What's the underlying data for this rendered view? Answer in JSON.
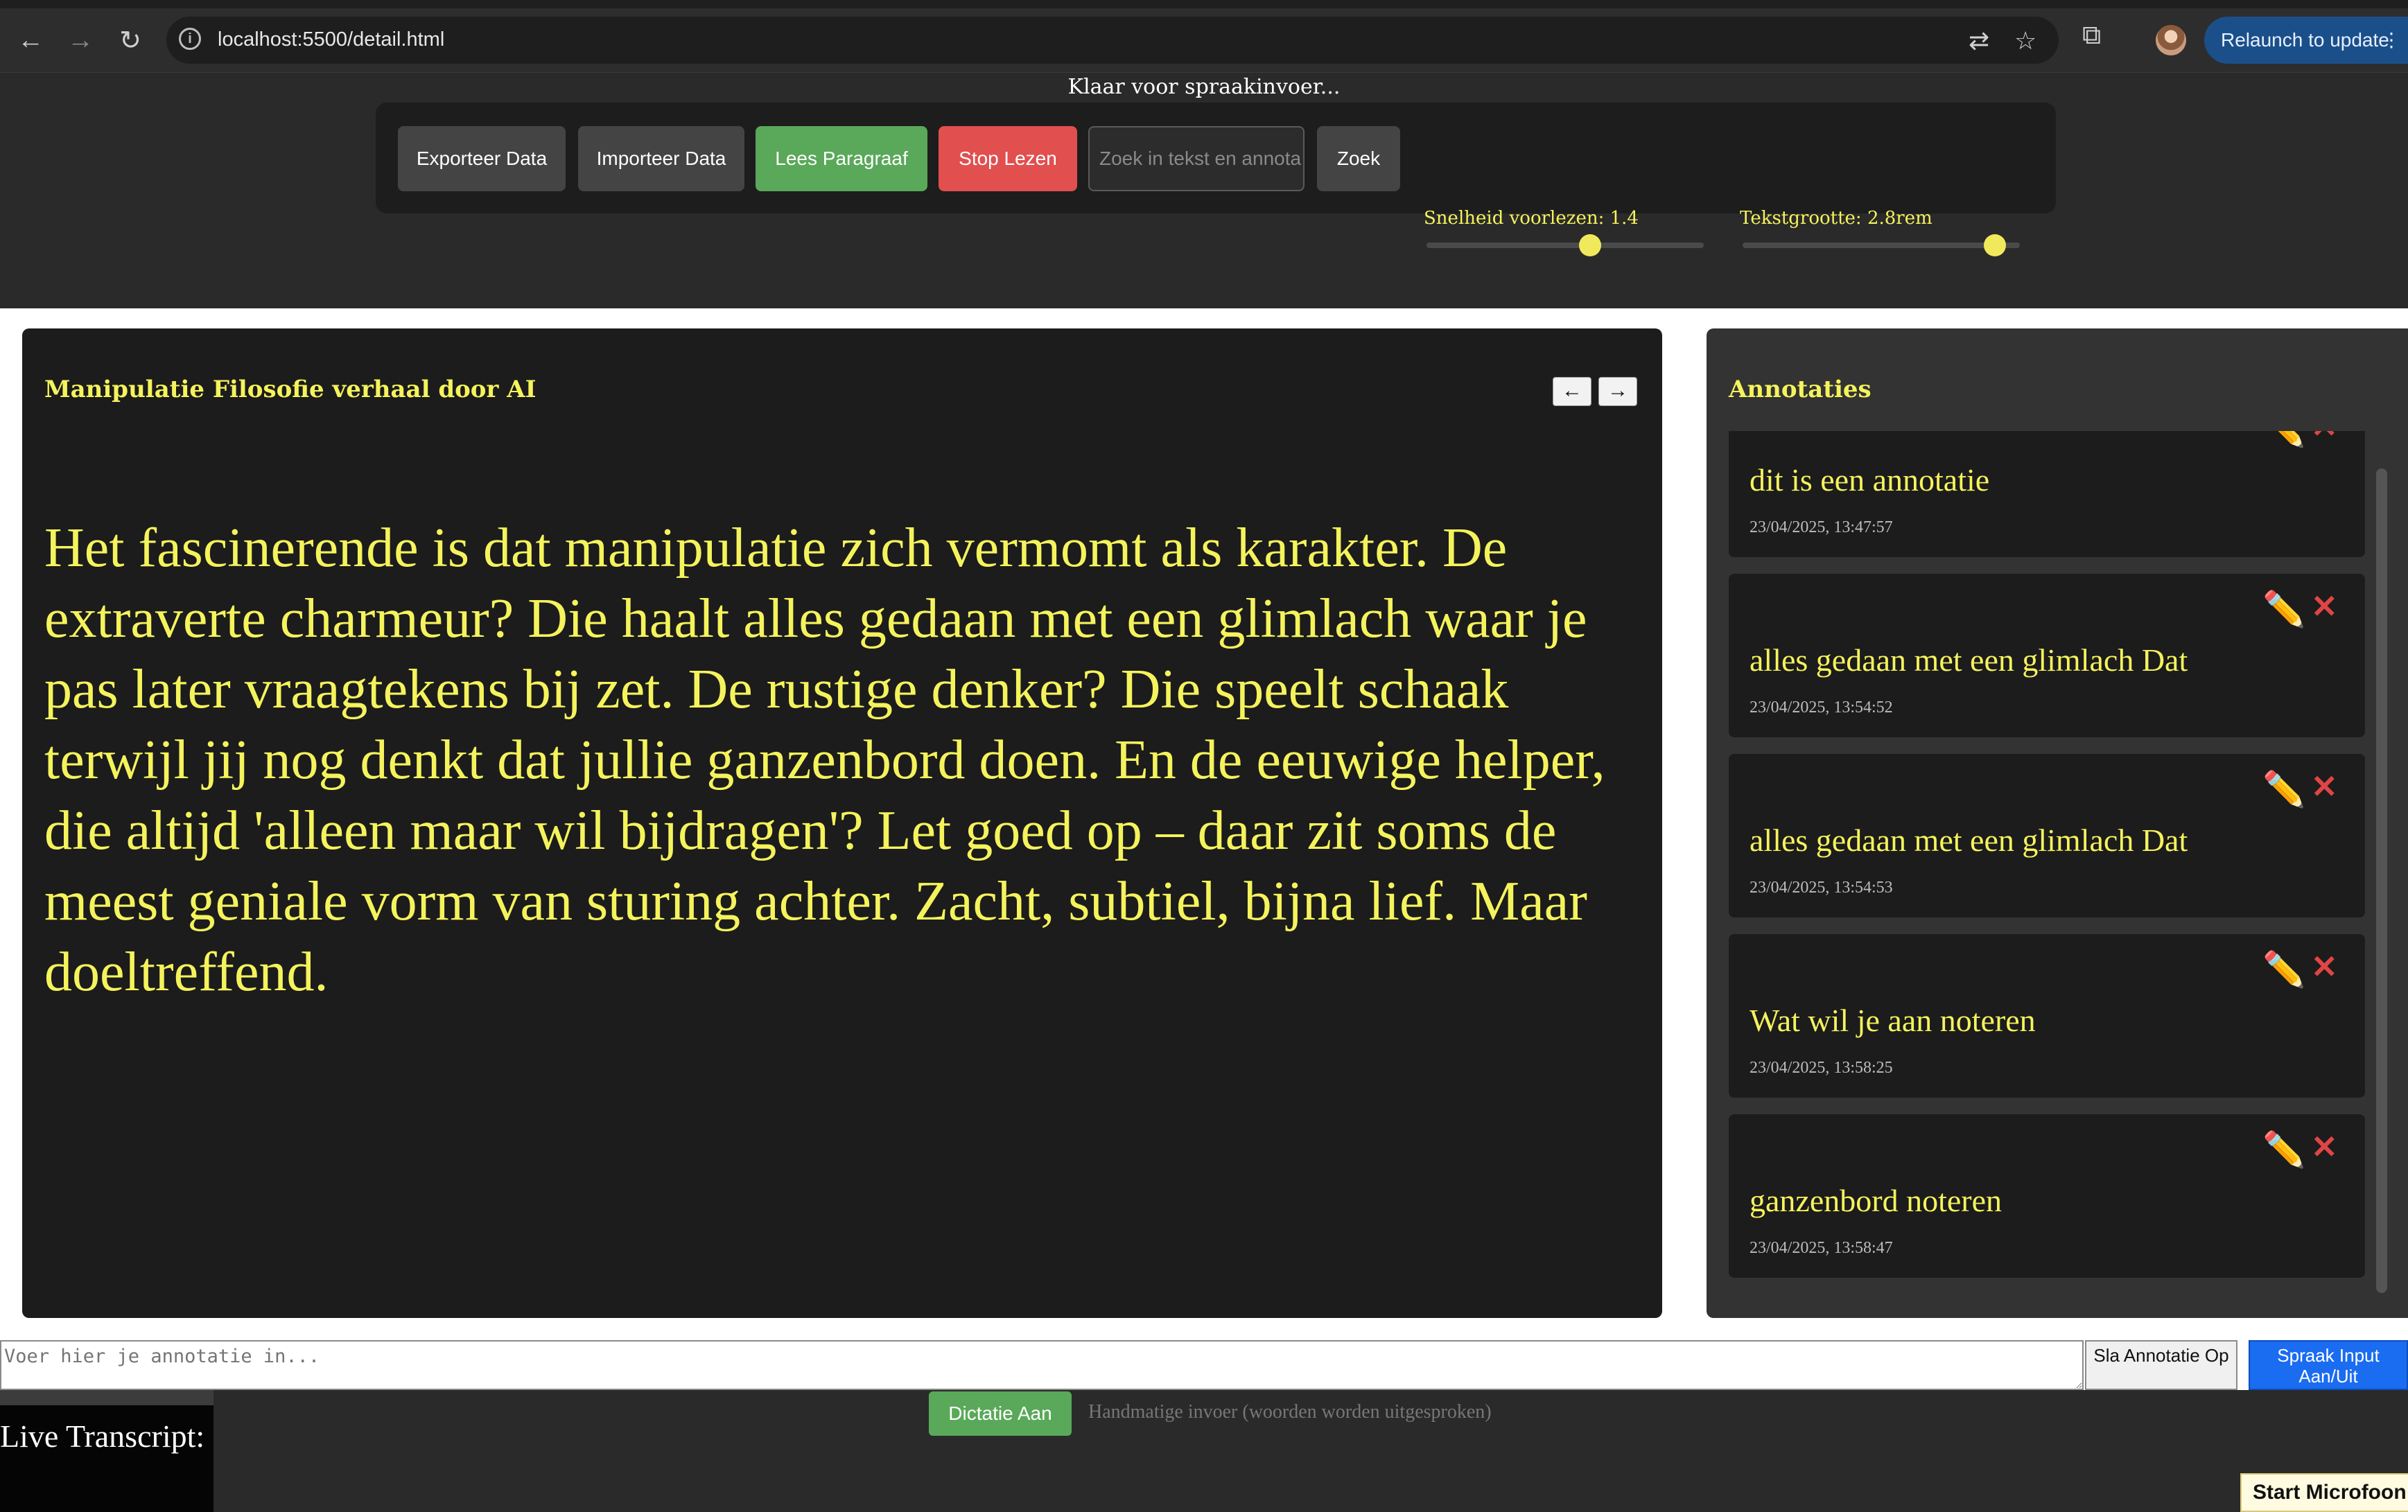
{
  "browser": {
    "url": "localhost:5500/detail.html",
    "relaunch_label": "Relaunch to update"
  },
  "status_text": "Klaar voor spraakinvoer...",
  "toolbar": {
    "export_label": "Exporteer Data",
    "import_label": "Importeer Data",
    "read_label": "Lees Paragraaf",
    "stop_label": "Stop Lezen",
    "search_placeholder": "Zoek in tekst en annota",
    "search_button_label": "Zoek",
    "speed_label": "Snelheid voorlezen: 1.4",
    "speed_value": 1.4,
    "font_size_label": "Tekstgrootte: 2.8rem",
    "font_size_value": "2.8rem"
  },
  "document": {
    "title": "Manipulatie Filosofie verhaal door AI",
    "prev_label": "←",
    "next_label": "→",
    "paragraph": "Het fascinerende is dat manipulatie zich vermomt als karakter. De extraverte charmeur? Die haalt alles gedaan met een glimlach waar je pas later vraagtekens bij zet. De rustige denker? Die speelt schaak terwijl jij nog denkt dat jullie ganzenbord doen. En de eeuwige helper, die altijd 'alleen maar wil bijdragen'? Let goed op – daar zit soms de meest geniale vorm van sturing achter. Zacht, subtiel, bijna lief. Maar doeltreffend."
  },
  "annotations": {
    "heading": "Annotaties",
    "edit_icon": "✏️",
    "delete_icon": "✕",
    "items": [
      {
        "text": "dit is een annotatie",
        "date": "23/04/2025, 13:47:57"
      },
      {
        "text": "alles gedaan met een glimlach Dat",
        "date": "23/04/2025, 13:54:52"
      },
      {
        "text": "alles gedaan met een glimlach Dat",
        "date": "23/04/2025, 13:54:53"
      },
      {
        "text": "Wat wil je aan noteren",
        "date": "23/04/2025, 13:58:25"
      },
      {
        "text": "ganzenbord noteren",
        "date": "23/04/2025, 13:58:47"
      }
    ]
  },
  "input": {
    "annotation_placeholder": "Voer hier je annotatie in...",
    "save_label": "Sla Annotatie Op",
    "voice_toggle_label": "Spraak Input Aan/Uit"
  },
  "footer": {
    "transcript_label": "Live Transcript:",
    "dictation_label": "Dictatie Aan",
    "dictation_hint": "Handmatige invoer (woorden worden uitgesproken)",
    "start_mic_label": "Start Microfoon"
  },
  "colors": {
    "accent_yellow": "#f5f35c",
    "green": "#5aa85a",
    "red": "#e14f4f",
    "blue": "#1a6cf0"
  }
}
